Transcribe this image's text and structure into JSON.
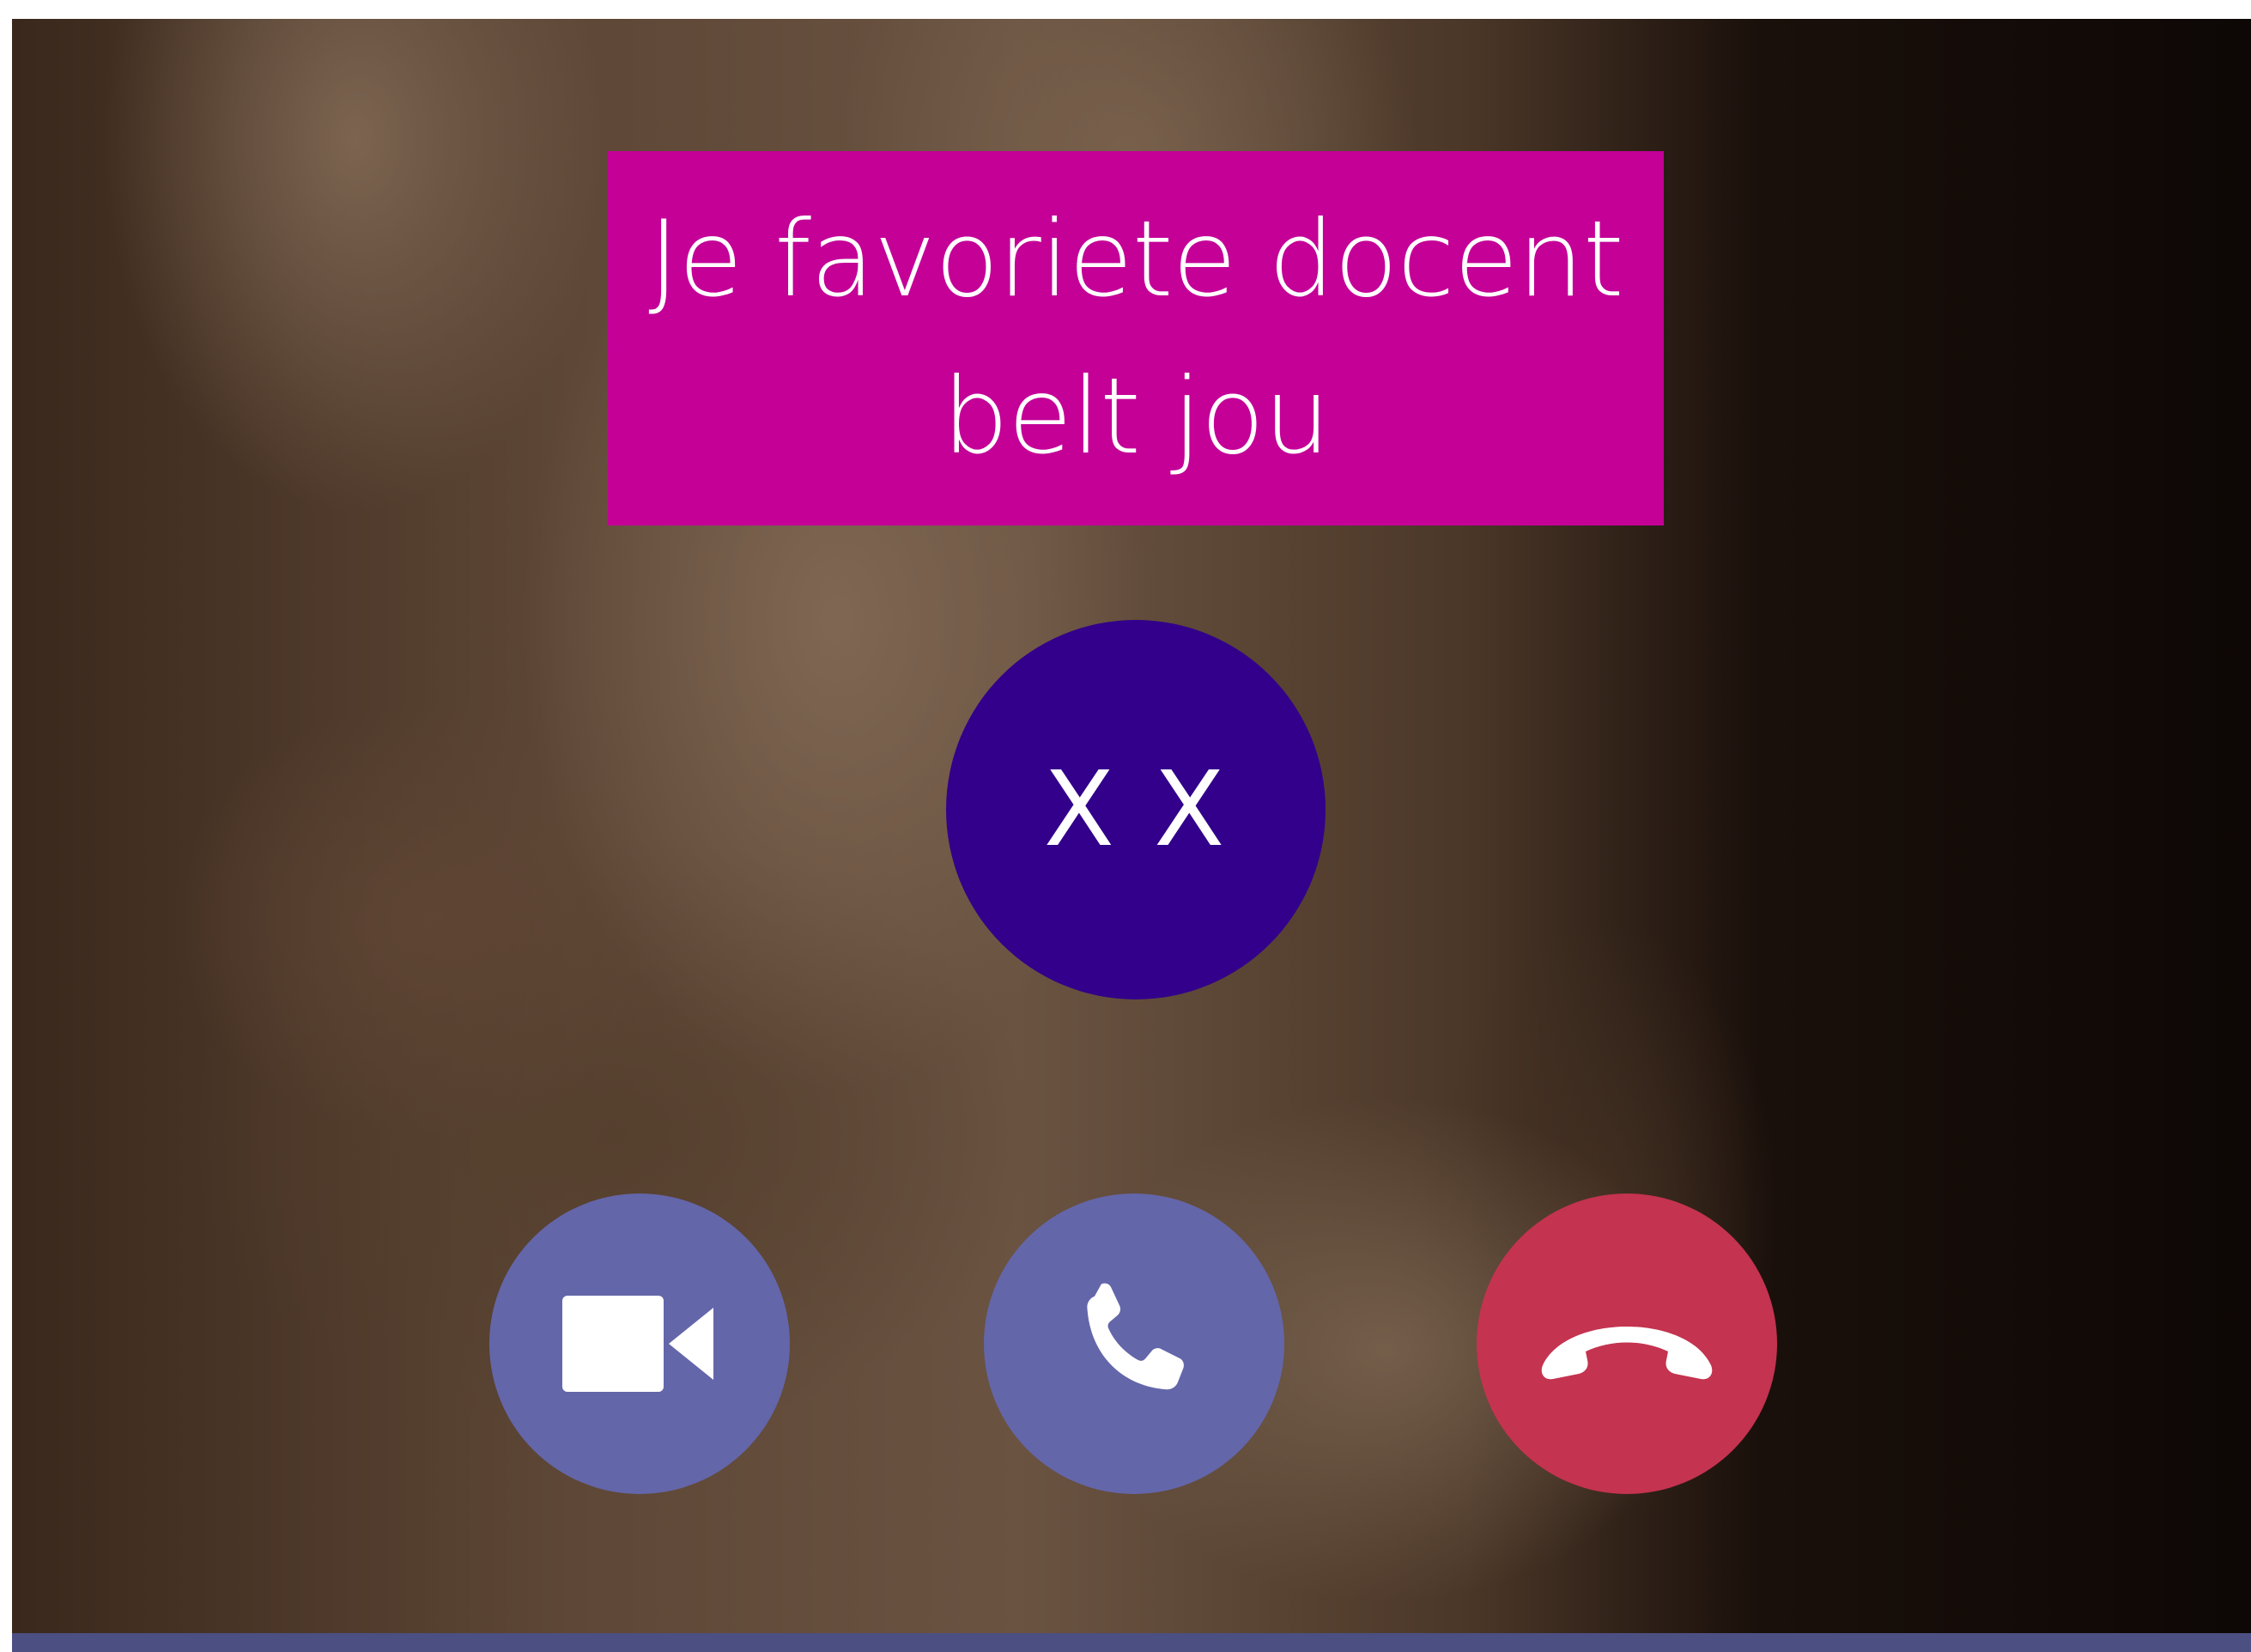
{
  "call": {
    "title_line1": "Je favoriete docent",
    "title_line2": "belt jou",
    "caller_initials": "X X"
  },
  "actions": [
    {
      "id": "video",
      "icon": "video-camera-icon",
      "color": "#6466aa"
    },
    {
      "id": "audio",
      "icon": "phone-icon",
      "color": "#6466aa"
    },
    {
      "id": "decline",
      "icon": "hang-up-icon",
      "color": "#c4334f"
    }
  ],
  "colors": {
    "title_background": "#c40097",
    "avatar_background": "#32008a",
    "bottom_bar": "#4c4f82"
  }
}
